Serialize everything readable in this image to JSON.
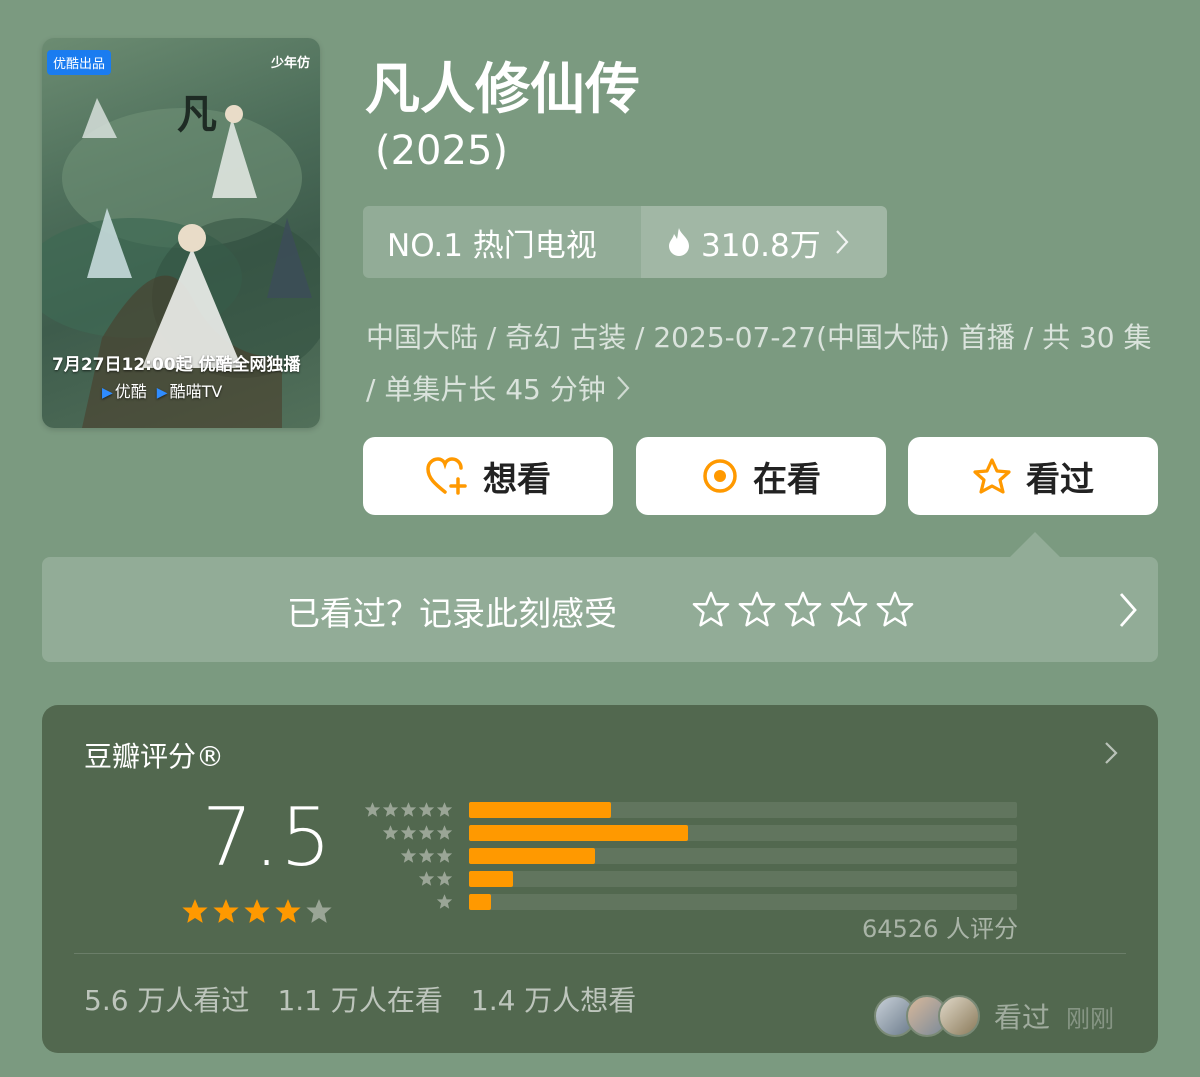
{
  "poster": {
    "badge": "优酷出品",
    "brand": "少年仿",
    "air_date": "7月27日12:00起 优酷全网独播",
    "platforms": [
      "优酷",
      "酷喵TV"
    ]
  },
  "show": {
    "title": "凡人修仙传",
    "year": "(2025)"
  },
  "rank": {
    "label": "NO.1 热门电视",
    "heat": "310.8万"
  },
  "meta": {
    "info": "中国大陆 / 奇幻 古装 / 2025-07-27(中国大陆) 首播 / 共 30 集 / 单集片长 45 分钟"
  },
  "actions": {
    "want": "想看",
    "watching": "在看",
    "watched": "看过"
  },
  "record": {
    "prompt": "已看过？记录此刻感受",
    "stars_total": 5
  },
  "rating": {
    "title": "豆瓣评分®",
    "score": "7.5",
    "stars_filled": 4,
    "stars_total": 5,
    "distribution": [
      {
        "stars": 5,
        "percent": 26
      },
      {
        "stars": 4,
        "percent": 40
      },
      {
        "stars": 3,
        "percent": 23
      },
      {
        "stars": 2,
        "percent": 8
      },
      {
        "stars": 1,
        "percent": 4
      }
    ],
    "count_text": "64526 人评分",
    "stats": [
      "5.6 万人看过",
      "1.1 万人在看",
      "1.4 万人想看"
    ],
    "recent_label": "看过",
    "recent_time": "刚刚"
  },
  "colors": {
    "background": "#7b9a80",
    "card": "#52684f",
    "accent_orange": "#ff9900",
    "star_grey": "#9aa596"
  }
}
